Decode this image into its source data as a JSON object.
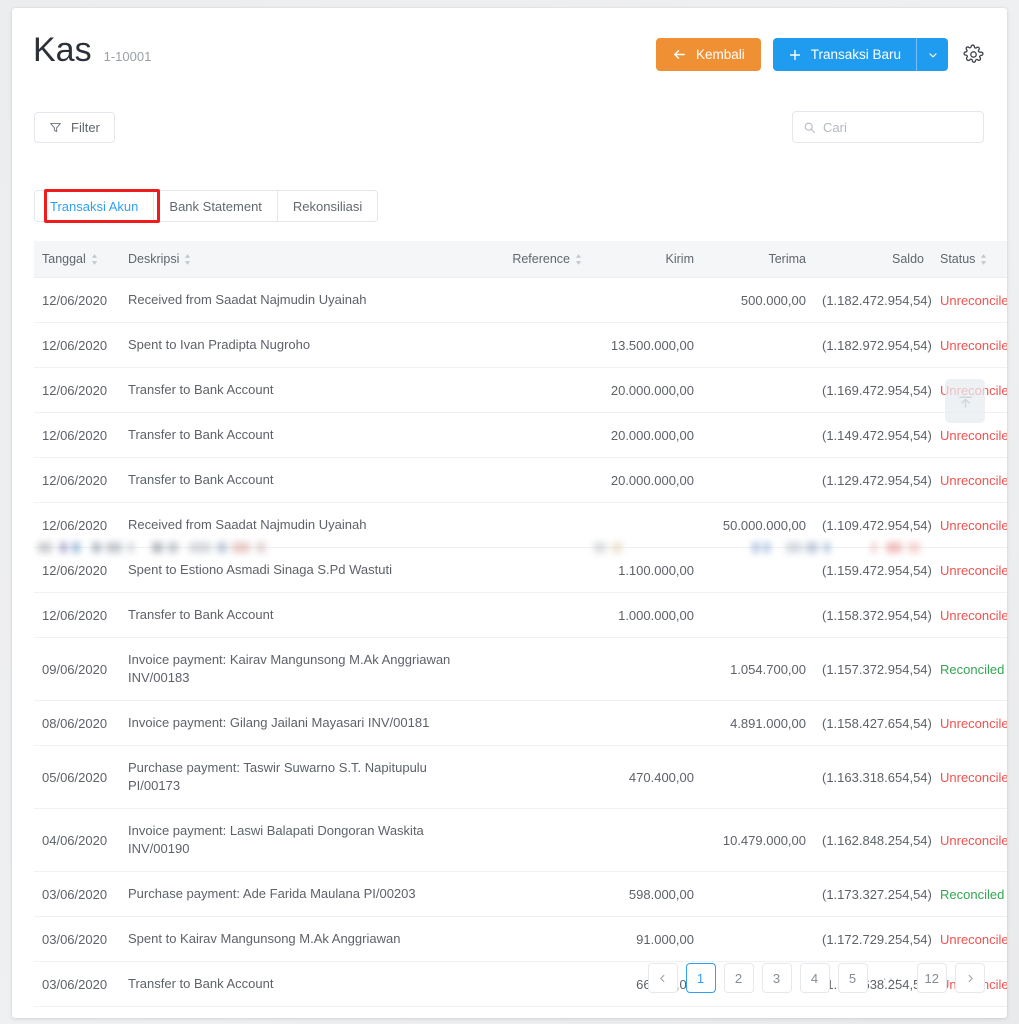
{
  "header": {
    "title": "Kas",
    "subtitle": "1-10001",
    "back_label": "Kembali",
    "new_label": "Transaksi Baru",
    "back_icon": "arrow-left-icon",
    "new_icon": "plus-icon",
    "caret_icon": "chevron-down-icon",
    "gear_icon": "gear-icon"
  },
  "toolbar": {
    "filter_label": "Filter",
    "filter_icon": "funnel-icon",
    "search_placeholder": "Cari",
    "search_value": "",
    "search_icon": "search-icon"
  },
  "tabs": [
    {
      "label": "Transaksi Akun",
      "active": true
    },
    {
      "label": "Bank Statement",
      "active": false
    },
    {
      "label": "Rekonsiliasi",
      "active": false
    }
  ],
  "table": {
    "columns": [
      {
        "key": "tanggal",
        "label": "Tanggal",
        "sortable": true,
        "align": "left"
      },
      {
        "key": "deskripsi",
        "label": "Deskripsi",
        "sortable": true,
        "align": "left"
      },
      {
        "key": "reference",
        "label": "Reference",
        "sortable": true,
        "align": "right"
      },
      {
        "key": "kirim",
        "label": "Kirim",
        "sortable": false,
        "align": "right"
      },
      {
        "key": "terima",
        "label": "Terima",
        "sortable": false,
        "align": "right"
      },
      {
        "key": "saldo",
        "label": "Saldo",
        "sortable": false,
        "align": "right"
      },
      {
        "key": "status",
        "label": "Status",
        "sortable": true,
        "align": "left"
      }
    ],
    "rows": [
      {
        "tanggal": "12/06/2020",
        "deskripsi": "Received from Saadat Najmudin Uyainah",
        "reference": "",
        "kirim": "",
        "terima": "500.000,00",
        "saldo": "(1.182.472.954,54)",
        "status": "Unreconciled"
      },
      {
        "tanggal": "12/06/2020",
        "deskripsi": "Spent to Ivan Pradipta Nugroho",
        "reference": "",
        "kirim": "13.500.000,00",
        "terima": "",
        "saldo": "(1.182.972.954,54)",
        "status": "Unreconciled"
      },
      {
        "tanggal": "12/06/2020",
        "deskripsi": "Transfer to Bank Account",
        "reference": "",
        "kirim": "20.000.000,00",
        "terima": "",
        "saldo": "(1.169.472.954,54)",
        "status": "Unreconciled"
      },
      {
        "tanggal": "12/06/2020",
        "deskripsi": "Transfer to Bank Account",
        "reference": "",
        "kirim": "20.000.000,00",
        "terima": "",
        "saldo": "(1.149.472.954,54)",
        "status": "Unreconciled"
      },
      {
        "tanggal": "12/06/2020",
        "deskripsi": "Transfer to Bank Account",
        "reference": "",
        "kirim": "20.000.000,00",
        "terima": "",
        "saldo": "(1.129.472.954,54)",
        "status": "Unreconciled"
      },
      {
        "tanggal": "12/06/2020",
        "deskripsi": "Received from Saadat Najmudin Uyainah",
        "reference": "",
        "kirim": "",
        "terima": "50.000.000,00",
        "saldo": "(1.109.472.954,54)",
        "status": "Unreconciled"
      },
      {
        "tanggal": "12/06/2020",
        "deskripsi": "Spent to Estiono Asmadi Sinaga S.Pd Wastuti",
        "reference": "",
        "kirim": "1.100.000,00",
        "terima": "",
        "saldo": "(1.159.472.954,54)",
        "status": "Unreconciled"
      },
      {
        "tanggal": "12/06/2020",
        "deskripsi": "Transfer to Bank Account",
        "reference": "",
        "kirim": "1.000.000,00",
        "terima": "",
        "saldo": "(1.158.372.954,54)",
        "status": "Unreconciled"
      },
      {
        "tanggal": "09/06/2020",
        "deskripsi": "Invoice payment: Kairav Mangunsong M.Ak Anggriawan INV/00183",
        "reference": "",
        "kirim": "",
        "terima": "1.054.700,00",
        "saldo": "(1.157.372.954,54)",
        "status": "Reconciled"
      },
      {
        "tanggal": "08/06/2020",
        "deskripsi": "Invoice payment: Gilang Jailani Mayasari INV/00181",
        "reference": "",
        "kirim": "",
        "terima": "4.891.000,00",
        "saldo": "(1.158.427.654,54)",
        "status": "Unreconciled"
      },
      {
        "tanggal": "05/06/2020",
        "deskripsi": "Purchase payment: Taswir Suwarno S.T. Napitupulu PI/00173",
        "reference": "",
        "kirim": "470.400,00",
        "terima": "",
        "saldo": "(1.163.318.654,54)",
        "status": "Unreconciled"
      },
      {
        "tanggal": "04/06/2020",
        "deskripsi": "Invoice payment: Laswi Balapati Dongoran Waskita INV/00190",
        "reference": "",
        "kirim": "",
        "terima": "10.479.000,00",
        "saldo": "(1.162.848.254,54)",
        "status": "Unreconciled"
      },
      {
        "tanggal": "03/06/2020",
        "deskripsi": "Purchase payment: Ade Farida Maulana PI/00203",
        "reference": "",
        "kirim": "598.000,00",
        "terima": "",
        "saldo": "(1.173.327.254,54)",
        "status": "Reconciled"
      },
      {
        "tanggal": "03/06/2020",
        "deskripsi": "Spent to Kairav Mangunsong M.Ak Anggriawan",
        "reference": "",
        "kirim": "91.000,00",
        "terima": "",
        "saldo": "(1.172.729.254,54)",
        "status": "Unreconciled"
      },
      {
        "tanggal": "03/06/2020",
        "deskripsi": "Transfer to Bank Account",
        "reference": "",
        "kirim": "66.000,00",
        "terima": "",
        "saldo": "(1.172.638.254,54)",
        "status": "Unreconciled"
      }
    ]
  },
  "pagination": {
    "prev_icon": "chevron-left-icon",
    "next_icon": "chevron-right-icon",
    "ellipsis": "···",
    "pages": [
      "1",
      "2",
      "3",
      "4",
      "5"
    ],
    "last_page": "12",
    "current": "1"
  },
  "scroll_top": {
    "icon": "arrow-up-icon"
  },
  "colors": {
    "accent_blue": "#1f9cf0",
    "accent_orange": "#ef9035",
    "status_unreconciled": "#ef5350",
    "status_reconciled": "#35a653",
    "annotation": "#f01c1c"
  }
}
